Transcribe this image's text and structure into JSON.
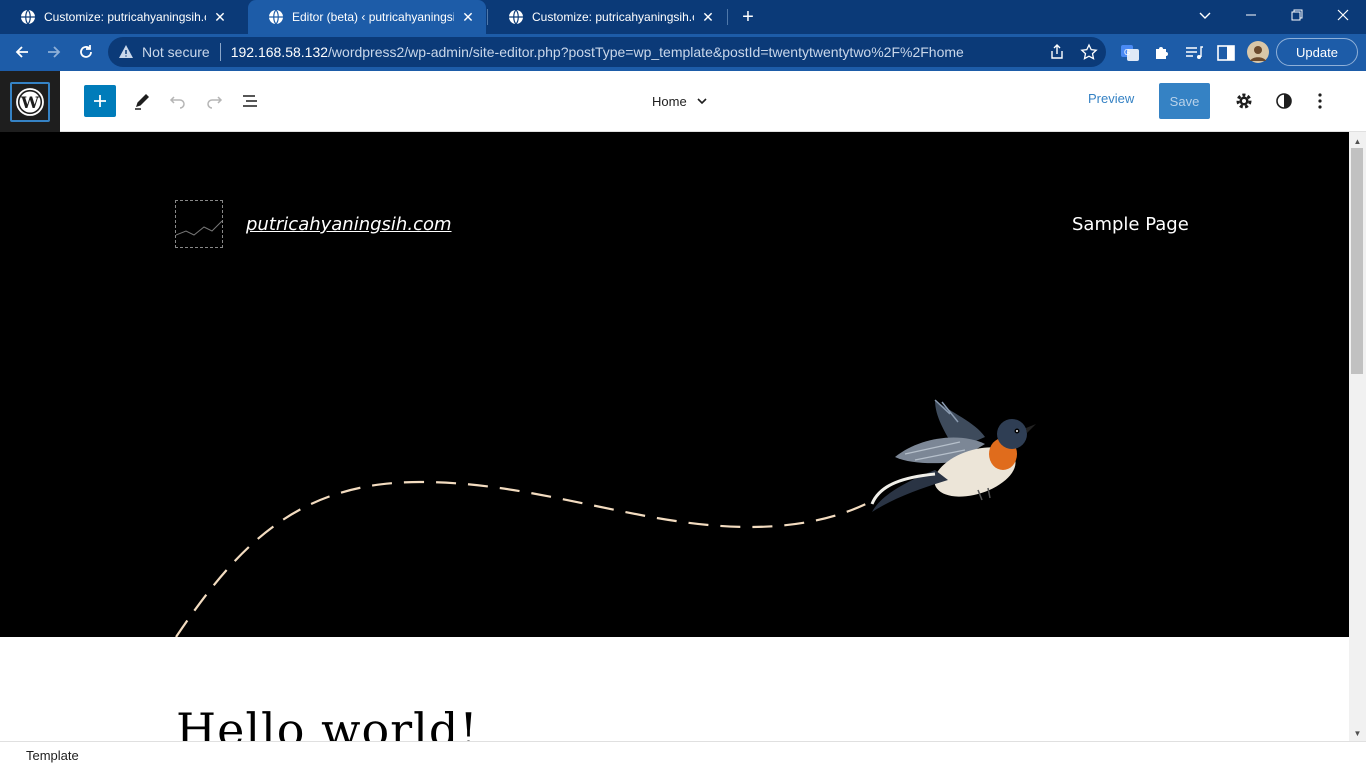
{
  "browser": {
    "tabs": [
      {
        "title": "Customize: putricahyaningsih.com",
        "active": false
      },
      {
        "title": "Editor (beta) ‹ putricahyaningsih.com",
        "active": true
      },
      {
        "title": "Customize: putricahyaningsih.com",
        "active": false
      }
    ],
    "new_tab_label": "+",
    "security_label": "Not secure",
    "url_host": "192.168.58.132",
    "url_path": "/wordpress2/wp-admin/site-editor.php?postType=wp_template&postId=twentytwentytwo%2F%2Fhome",
    "update_label": "Update",
    "colors": {
      "frame": "#0b3a78",
      "toolbar": "#1d5ca8"
    }
  },
  "editor": {
    "template_name": "Home",
    "preview_label": "Preview",
    "save_label": "Save",
    "accent": "#007cba"
  },
  "canvas": {
    "site_title": "putricahyaningsih.com",
    "nav_items": [
      "Sample Page"
    ],
    "post_title": "Hello world!",
    "hero_background": "#000000"
  },
  "footer": {
    "breadcrumb": "Template"
  }
}
